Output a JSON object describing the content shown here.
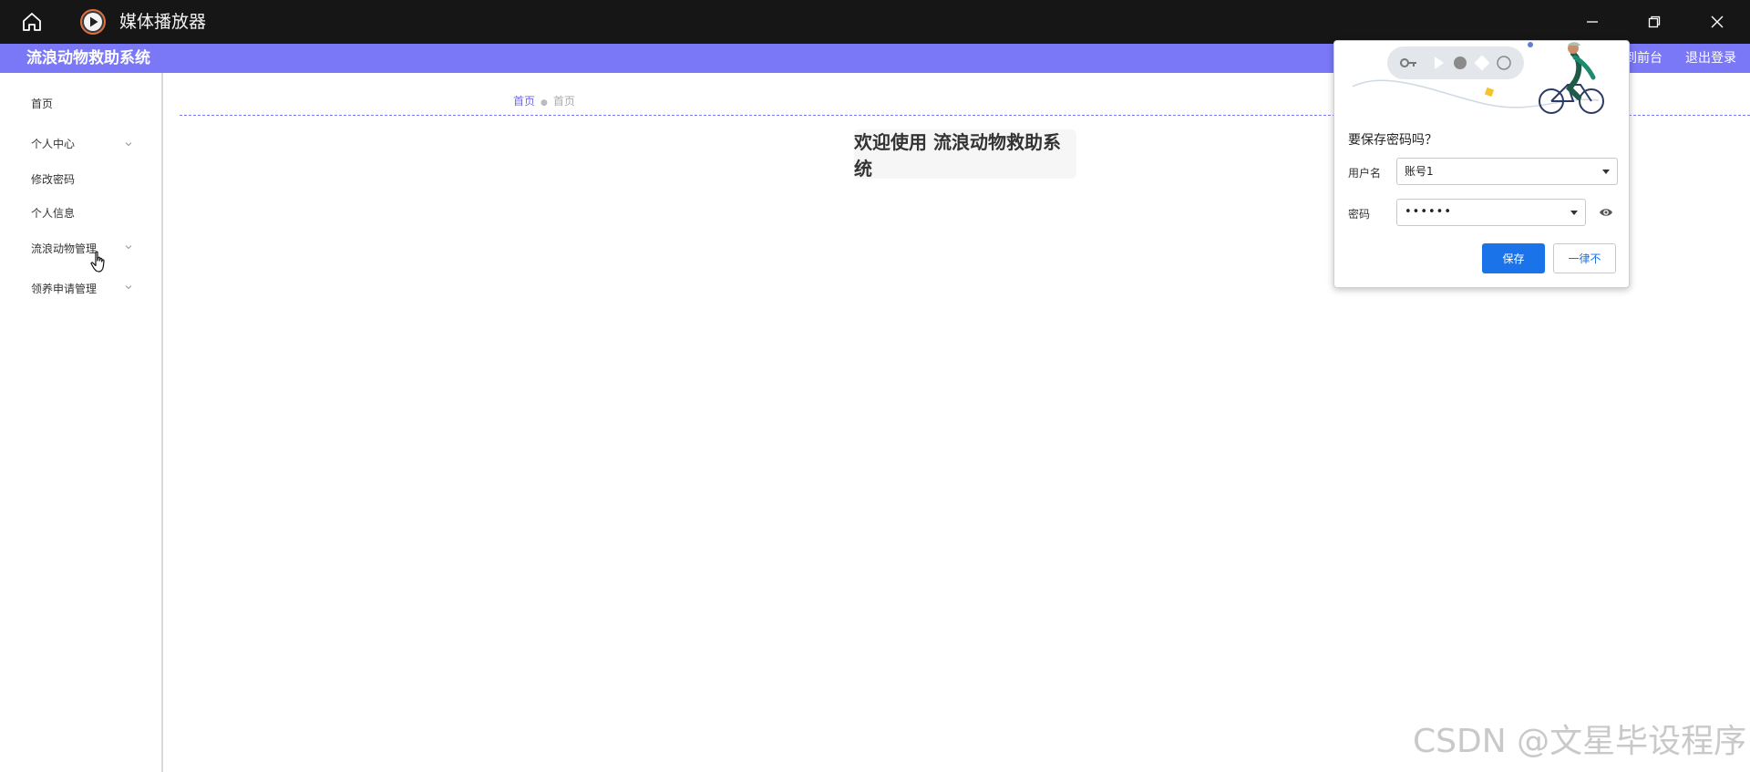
{
  "window": {
    "title": "媒体播放器",
    "home_icon": "home-icon",
    "app_icon": "play-circle-icon",
    "controls": [
      "minimize-icon",
      "maximize-icon",
      "close-icon"
    ]
  },
  "app": {
    "title": "流浪动物救助系统",
    "header_links": [
      "到前台",
      "退出登录"
    ],
    "header_color": "#7a78f6"
  },
  "sidebar": {
    "items": [
      {
        "label": "首页",
        "has_submenu": false
      },
      {
        "label": "个人中心",
        "has_submenu": true
      },
      {
        "label": "修改密码",
        "has_submenu": false
      },
      {
        "label": "个人信息",
        "has_submenu": false
      },
      {
        "label": "流浪动物管理",
        "has_submenu": true
      },
      {
        "label": "领养申请管理",
        "has_submenu": true
      }
    ]
  },
  "breadcrumb": {
    "home": "首页",
    "current": "首页"
  },
  "main": {
    "welcome": "欢迎使用 流浪动物救助系统"
  },
  "password_popup": {
    "question": "要保存密码吗？",
    "username_label": "用户名",
    "username_value": "账号1",
    "password_label": "密码",
    "password_value": "••••••",
    "save_label": "保存",
    "never_label": "一律不",
    "accent": "#1a73e8"
  },
  "watermark": "CSDN @文星毕设程序"
}
